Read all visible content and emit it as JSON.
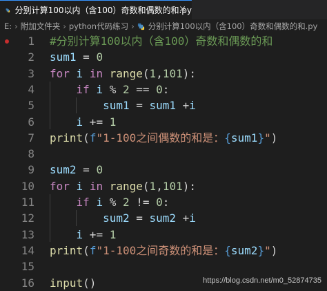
{
  "tab": {
    "title": "分别计算100以内（含100）奇数和偶数的和.py",
    "close_glyph": "×"
  },
  "breadcrumb": [
    "E:",
    "附加文件夹",
    "python代码练习",
    "分别计算100以内（含100）奇数和偶数的和.py"
  ],
  "code_lines": [
    {
      "n": "1",
      "tokens": [
        {
          "t": "#分别计算100以内（含100）奇数和偶数的和",
          "c": "cm"
        }
      ]
    },
    {
      "n": "2",
      "tokens": [
        {
          "t": "sum1",
          "c": "var"
        },
        {
          "t": " = ",
          "c": "br"
        },
        {
          "t": "0",
          "c": "num"
        }
      ]
    },
    {
      "n": "3",
      "tokens": [
        {
          "t": "for",
          "c": "kw"
        },
        {
          "t": " ",
          "c": "br"
        },
        {
          "t": "i",
          "c": "var"
        },
        {
          "t": " ",
          "c": "br"
        },
        {
          "t": "in",
          "c": "kw"
        },
        {
          "t": " ",
          "c": "br"
        },
        {
          "t": "range",
          "c": "fn"
        },
        {
          "t": "(",
          "c": "br"
        },
        {
          "t": "1",
          "c": "num"
        },
        {
          "t": ",",
          "c": "br"
        },
        {
          "t": "101",
          "c": "num"
        },
        {
          "t": "):",
          "c": "br"
        }
      ]
    },
    {
      "n": "4",
      "tokens": [
        {
          "t": "    ",
          "c": "br"
        },
        {
          "t": "if",
          "c": "kw"
        },
        {
          "t": " ",
          "c": "br"
        },
        {
          "t": "i",
          "c": "var"
        },
        {
          "t": " % ",
          "c": "br"
        },
        {
          "t": "2",
          "c": "num"
        },
        {
          "t": " == ",
          "c": "br"
        },
        {
          "t": "0",
          "c": "num"
        },
        {
          "t": ":",
          "c": "br"
        }
      ]
    },
    {
      "n": "5",
      "tokens": [
        {
          "t": "        ",
          "c": "br"
        },
        {
          "t": "sum1",
          "c": "var"
        },
        {
          "t": " = ",
          "c": "br"
        },
        {
          "t": "sum1",
          "c": "var"
        },
        {
          "t": " +",
          "c": "br"
        },
        {
          "t": "i",
          "c": "var"
        }
      ]
    },
    {
      "n": "6",
      "tokens": [
        {
          "t": "    ",
          "c": "br"
        },
        {
          "t": "i",
          "c": "var"
        },
        {
          "t": " += ",
          "c": "br"
        },
        {
          "t": "1",
          "c": "num"
        }
      ]
    },
    {
      "n": "7",
      "tokens": [
        {
          "t": "print",
          "c": "fn"
        },
        {
          "t": "(",
          "c": "br"
        },
        {
          "t": "f",
          "c": "fpre"
        },
        {
          "t": "\"1-100之间偶数的和是：",
          "c": "str"
        },
        {
          "t": "{",
          "c": "brace"
        },
        {
          "t": "sum1",
          "c": "var"
        },
        {
          "t": "}",
          "c": "brace"
        },
        {
          "t": "\"",
          "c": "str"
        },
        {
          "t": ")",
          "c": "br"
        }
      ]
    },
    {
      "n": "8",
      "tokens": []
    },
    {
      "n": "9",
      "tokens": [
        {
          "t": "sum2",
          "c": "var"
        },
        {
          "t": " = ",
          "c": "br"
        },
        {
          "t": "0",
          "c": "num"
        }
      ]
    },
    {
      "n": "10",
      "tokens": [
        {
          "t": "for",
          "c": "kw"
        },
        {
          "t": " ",
          "c": "br"
        },
        {
          "t": "i",
          "c": "var"
        },
        {
          "t": " ",
          "c": "br"
        },
        {
          "t": "in",
          "c": "kw"
        },
        {
          "t": " ",
          "c": "br"
        },
        {
          "t": "range",
          "c": "fn"
        },
        {
          "t": "(",
          "c": "br"
        },
        {
          "t": "1",
          "c": "num"
        },
        {
          "t": ",",
          "c": "br"
        },
        {
          "t": "101",
          "c": "num"
        },
        {
          "t": "):",
          "c": "br"
        }
      ]
    },
    {
      "n": "11",
      "tokens": [
        {
          "t": "    ",
          "c": "br"
        },
        {
          "t": "if",
          "c": "kw"
        },
        {
          "t": " ",
          "c": "br"
        },
        {
          "t": "i",
          "c": "var"
        },
        {
          "t": " % ",
          "c": "br"
        },
        {
          "t": "2",
          "c": "num"
        },
        {
          "t": " != ",
          "c": "br"
        },
        {
          "t": "0",
          "c": "num"
        },
        {
          "t": ":",
          "c": "br"
        }
      ]
    },
    {
      "n": "12",
      "tokens": [
        {
          "t": "        ",
          "c": "br"
        },
        {
          "t": "sum2",
          "c": "var"
        },
        {
          "t": " = ",
          "c": "br"
        },
        {
          "t": "sum2",
          "c": "var"
        },
        {
          "t": " +",
          "c": "br"
        },
        {
          "t": "i",
          "c": "var"
        }
      ]
    },
    {
      "n": "13",
      "tokens": [
        {
          "t": "    ",
          "c": "br"
        },
        {
          "t": "i",
          "c": "var"
        },
        {
          "t": " += ",
          "c": "br"
        },
        {
          "t": "1",
          "c": "num"
        }
      ]
    },
    {
      "n": "14",
      "tokens": [
        {
          "t": "print",
          "c": "fn"
        },
        {
          "t": "(",
          "c": "br"
        },
        {
          "t": "f",
          "c": "fpre"
        },
        {
          "t": "\"1-100之间奇数的和是：",
          "c": "str"
        },
        {
          "t": "{",
          "c": "brace"
        },
        {
          "t": "sum2",
          "c": "var"
        },
        {
          "t": "}",
          "c": "brace"
        },
        {
          "t": "\"",
          "c": "str"
        },
        {
          "t": ")",
          "c": "br"
        }
      ]
    },
    {
      "n": "15",
      "tokens": []
    },
    {
      "n": "16",
      "tokens": [
        {
          "t": "input",
          "c": "fn"
        },
        {
          "t": "()",
          "c": "br"
        }
      ]
    }
  ],
  "watermark": "https://blog.csdn.net/m0_52874735"
}
